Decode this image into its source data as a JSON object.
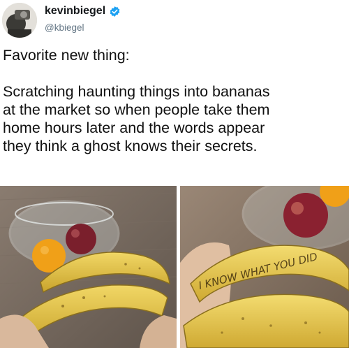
{
  "tweet": {
    "author": {
      "display_name": "kevinbiegel",
      "handle": "@kbiegel",
      "verified": true
    },
    "text_lines": [
      "Favorite new thing:",
      "",
      "Scratching haunting things into bananas",
      "at the market so when people take them",
      "home hours later and the words appear",
      "they think a ghost knows their secrets."
    ],
    "photos": [
      {
        "subject": "bananas-with-fruit-bowl"
      },
      {
        "subject": "banana-with-scratched-words",
        "scratched_text": "I KNOW WHAT YOU DID"
      }
    ]
  },
  "colors": {
    "verified_blue": "#1da1f2",
    "banana_yellow": "#e8c84a",
    "handle_gray": "#657786"
  }
}
